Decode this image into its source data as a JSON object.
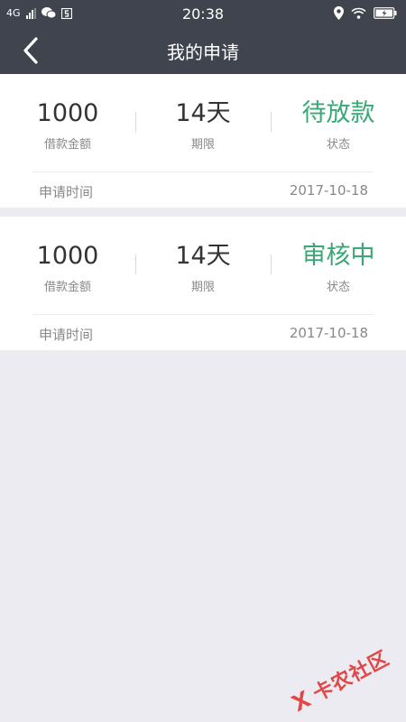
{
  "status_bar": {
    "network": "4G",
    "time": "20:38"
  },
  "header": {
    "title": "我的申请"
  },
  "applications": [
    {
      "amount": "1000",
      "amount_label": "借款金额",
      "term": "14天",
      "term_label": "期限",
      "status": "待放款",
      "status_label": "状态",
      "time_label": "申请时间",
      "time": "2017-10-18"
    },
    {
      "amount": "1000",
      "amount_label": "借款金额",
      "term": "14天",
      "term_label": "期限",
      "status": "审核中",
      "status_label": "状态",
      "time_label": "申请时间",
      "time": "2017-10-18"
    }
  ],
  "watermark": {
    "text": "卡农社区"
  },
  "colors": {
    "header_bg": "#3f444e",
    "status_green": "#3aa876",
    "page_bg": "#ebebf1"
  },
  "icons": [
    "back-arrow-icon",
    "signal-icon",
    "wechat-icon",
    "location-icon",
    "wifi-icon",
    "battery-icon",
    "watermark-logo-icon"
  ]
}
